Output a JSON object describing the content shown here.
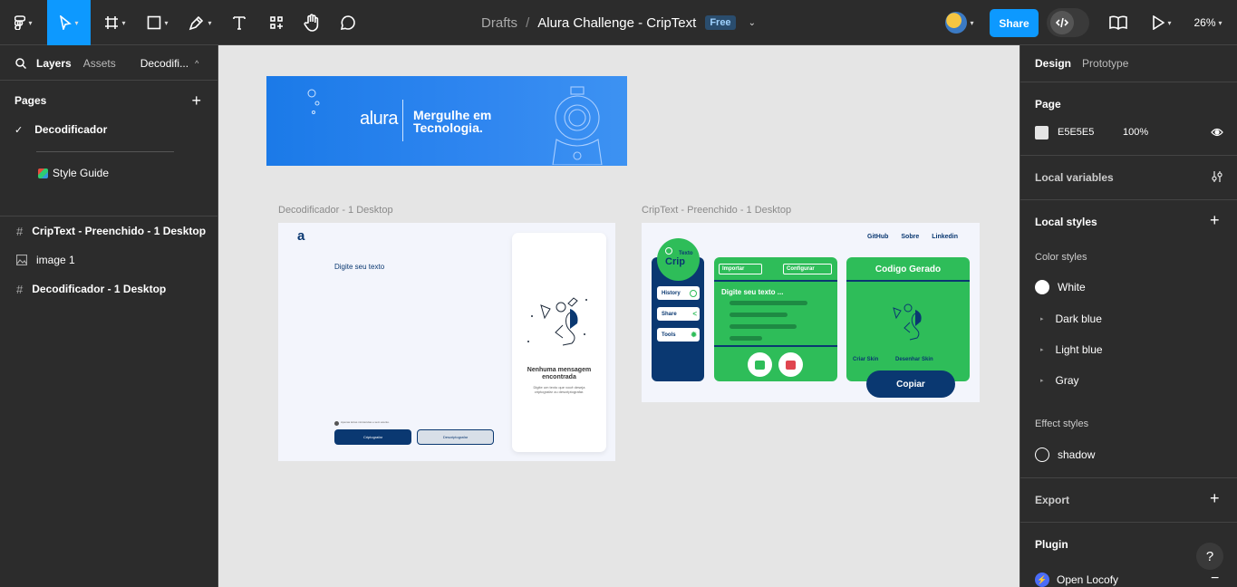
{
  "toolbar": {
    "breadcrumb_root": "Drafts",
    "separator": "/",
    "file_name": "Alura Challenge - CripText",
    "plan_badge": "Free",
    "share_label": "Share",
    "zoom": "26%"
  },
  "left": {
    "tabs": {
      "layers": "Layers",
      "assets": "Assets",
      "page": "Decodifi..."
    },
    "pages_title": "Pages",
    "pages": [
      {
        "label": "Decodificador"
      },
      {
        "label": "Style Guide"
      }
    ],
    "layers": [
      {
        "label": "CripText - Preenchido - 1 Desktop"
      },
      {
        "label": "image 1"
      },
      {
        "label": "Decodificador - 1 Desktop"
      }
    ]
  },
  "canvas": {
    "banner": {
      "brand": "alura",
      "tagline1": "Mergulhe em",
      "tagline2": "Tecnologia."
    },
    "frame1": {
      "label": "Decodificador - 1 Desktop",
      "logo": "a",
      "placeholder": "Digite seu texto",
      "btn_encrypt": "Criptografar",
      "btn_decrypt": "Descriptografar",
      "hint": "Apenas letras minúsculas e sem acento.",
      "empty_title": "Nenhuma mensagem encontrada",
      "empty_sub": "Digite um texto que você deseja criptografar ou descriptografar."
    },
    "frame2": {
      "label": "CripText - Preenchido - 1 Desktop",
      "nav": [
        "GitHub",
        "Sobre",
        "Linkedin"
      ],
      "logo_small": "Texto",
      "logo_big": "Crip",
      "side_buttons": [
        "History",
        "Share",
        "Tools"
      ],
      "import_label": "Importar",
      "config_label": "Configurar",
      "input_text": "Digite seu texto ...",
      "code_title": "Codigo Gerado",
      "skin_create": "Criar Skin",
      "skin_draw": "Desenhar Skin",
      "copy_label": "Copiar"
    }
  },
  "right": {
    "tabs": {
      "design": "Design",
      "prototype": "Prototype"
    },
    "page_title": "Page",
    "page_color": "E5E5E5",
    "page_opacity": "100%",
    "local_variables": "Local variables",
    "local_styles": "Local styles",
    "color_styles_title": "Color styles",
    "color_styles": [
      {
        "label": "White"
      },
      {
        "label": "Dark blue"
      },
      {
        "label": "Light blue"
      },
      {
        "label": "Gray"
      }
    ],
    "effect_styles_title": "Effect styles",
    "effect_styles": [
      {
        "label": "shadow"
      }
    ],
    "export": "Export",
    "plugin": "Plugin",
    "plugin_item": "Open Locofy",
    "help": "?"
  },
  "colors": {
    "accent": "#0d99ff",
    "canvas": "#e5e5e5",
    "dark_blue": "#0a3871",
    "green": "#2ebd59"
  }
}
